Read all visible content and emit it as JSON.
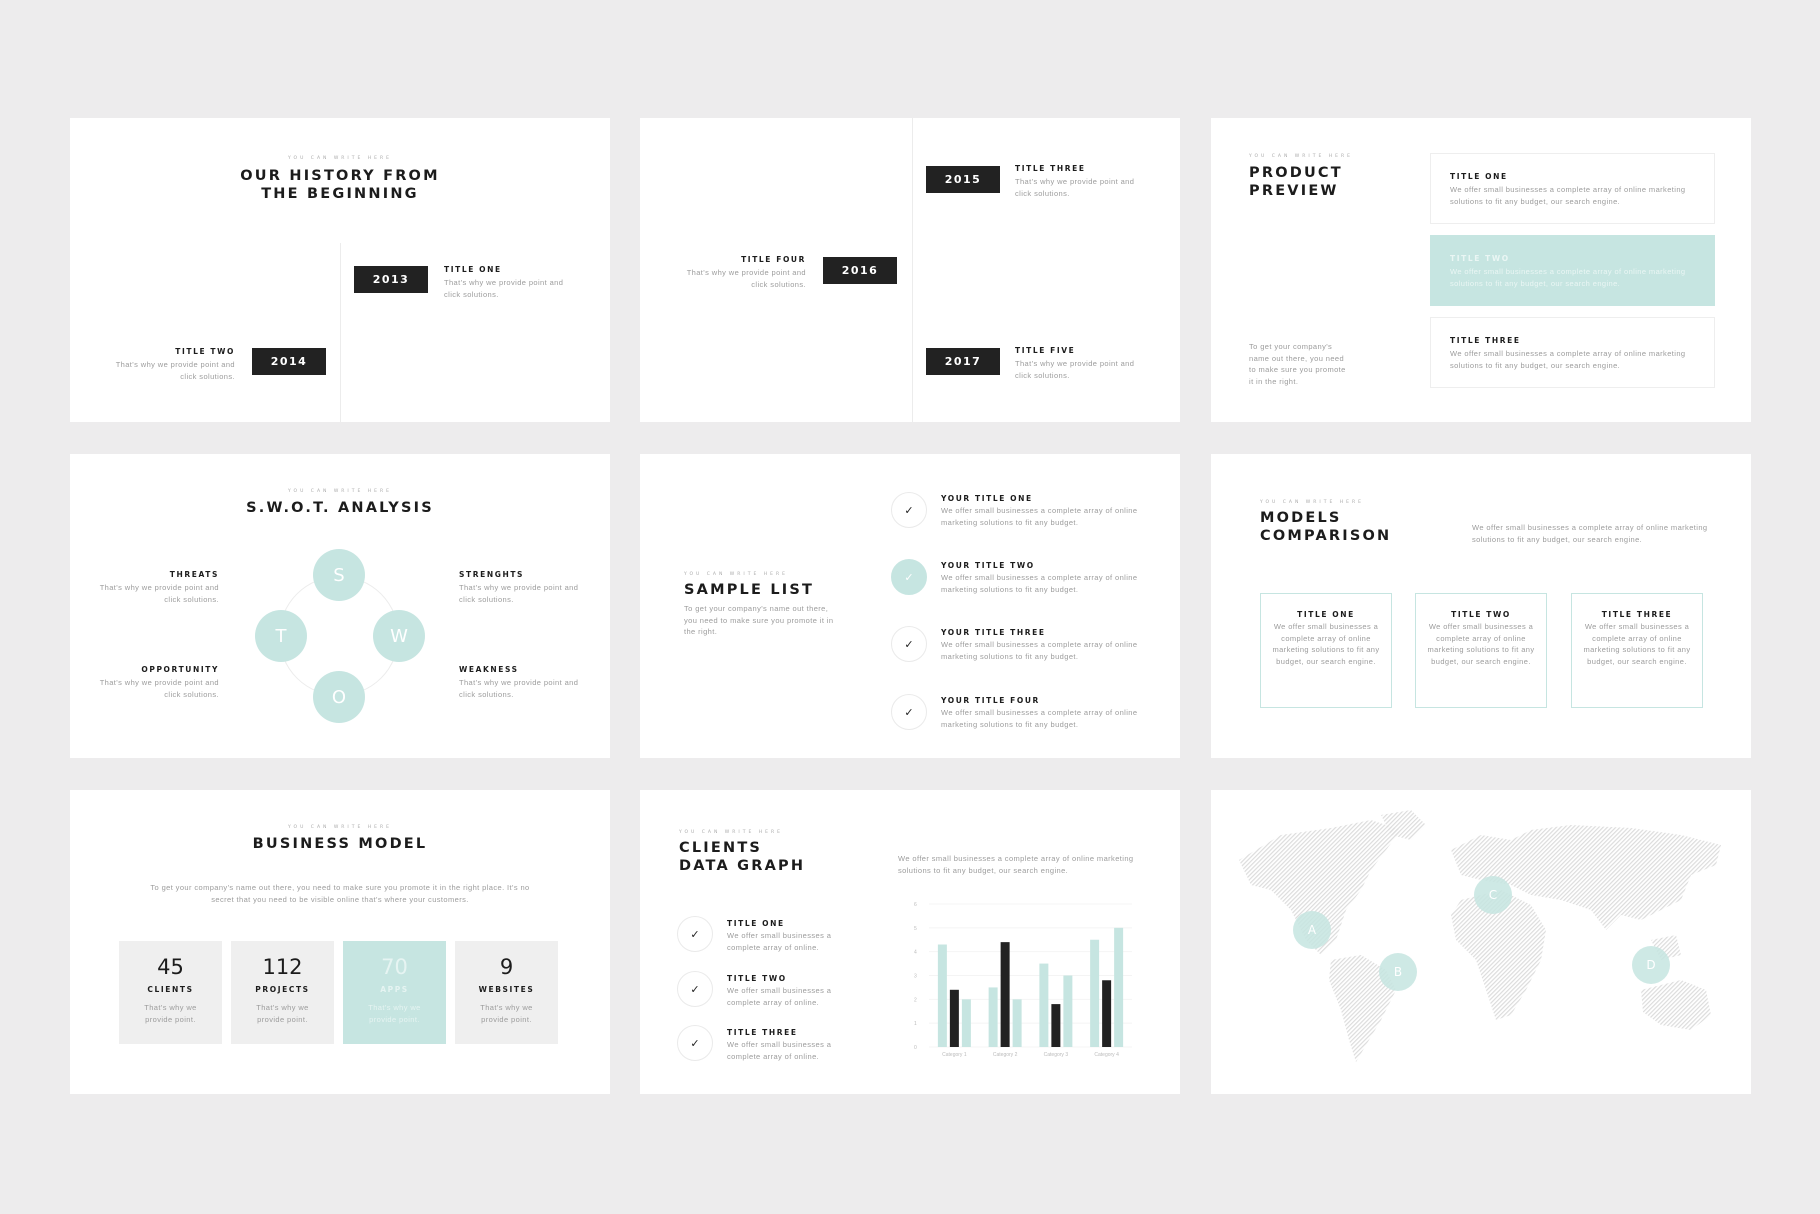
{
  "accent": "#c6e5e1",
  "common": {
    "label": "You can write here",
    "point": "That's why we provide point and click solutions.",
    "offer": "We offer small businesses a complete array of online marketing solutions to fit any budget, our search engine.",
    "offer_short": "We offer small businesses a complete array of online marketing solutions to fit any budget.",
    "offer_mini": "We offer small businesses a complete array of online.",
    "company": "To get your company's name out there, you need to make sure you promote it in the right."
  },
  "history": {
    "title1": "OUR HISTORY FROM",
    "title2": "THE BEGINNING",
    "items": [
      {
        "year": "2013",
        "title": "TITLE ONE"
      },
      {
        "year": "2014",
        "title": "TITLE TWO"
      }
    ]
  },
  "timeline": {
    "items": [
      {
        "year": "2015",
        "title": "TITLE THREE"
      },
      {
        "year": "2016",
        "title": "TITLE FOUR"
      },
      {
        "year": "2017",
        "title": "TITLE FIVE"
      }
    ]
  },
  "product": {
    "title1": "PRODUCT",
    "title2": "PREVIEW",
    "items": [
      "TITLE ONE",
      "TITLE TWO",
      "TITLE THREE"
    ]
  },
  "swot": {
    "title": "S.W.O.T. ANALYSIS",
    "letters": [
      "S",
      "W",
      "O",
      "T"
    ],
    "items": [
      "THREATS",
      "STRENGHTS",
      "OPPORTUNITY",
      "WEAKNESS"
    ]
  },
  "sample": {
    "title": "SAMPLE LIST",
    "text": "To get your company's name out there, you need to make sure you promote it in the right.",
    "items": [
      "YOUR TITLE ONE",
      "YOUR TITLE TWO",
      "YOUR TITLE THREE",
      "YOUR TITLE FOUR"
    ]
  },
  "models": {
    "title1": "MODELS",
    "title2": "COMPARISON",
    "body": "We offer small businesses a complete array of online marketing solutions to fit any budget, our search engine.",
    "items": [
      "TITLE ONE",
      "TITLE TWO",
      "TITLE THREE"
    ]
  },
  "business": {
    "title": "BUSINESS MODEL",
    "text": "To get your company's name out there, you need to make sure you promote it in the right place. It's no secret that you need to be visible online that's where your customers.",
    "stats": [
      {
        "value": "45",
        "label": "CLIENTS"
      },
      {
        "value": "112",
        "label": "PROJECTS"
      },
      {
        "value": "70",
        "label": "APPS"
      },
      {
        "value": "9",
        "label": "WEBSITES"
      }
    ],
    "desc": "That's why we provide point."
  },
  "clients": {
    "title1": "CLIENTS",
    "title2": "DATA GRAPH",
    "items": [
      "TITLE ONE",
      "TITLE TWO",
      "TITLE THREE"
    ]
  },
  "chart_data": {
    "type": "bar",
    "categories": [
      "Category 1",
      "Category 2",
      "Category 3",
      "Category 4"
    ],
    "series": [
      {
        "values": [
          4.3,
          2.5,
          3.5,
          4.5
        ],
        "color": "#c6e5e1"
      },
      {
        "values": [
          2.4,
          4.4,
          1.8,
          2.8
        ],
        "color": "#222222"
      },
      {
        "values": [
          2.0,
          2.0,
          3.0,
          5.0
        ],
        "color": "#c6e5e1"
      }
    ],
    "ylim": [
      0,
      6
    ],
    "yticks": [
      "0",
      "1",
      "2",
      "3",
      "4",
      "5",
      "6"
    ]
  },
  "map": {
    "markers": [
      "A",
      "B",
      "C",
      "D"
    ]
  }
}
